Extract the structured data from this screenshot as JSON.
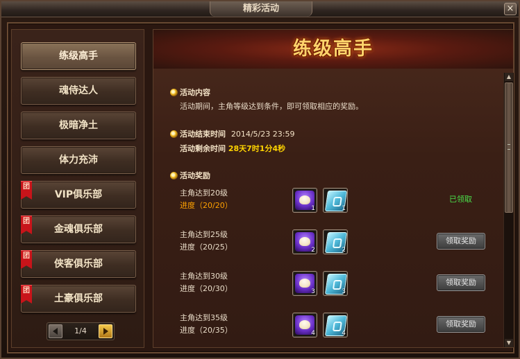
{
  "window": {
    "title": "精彩活动",
    "close_label": "×"
  },
  "sidebar": {
    "items": [
      {
        "label": "练级高手",
        "active": true,
        "badge": ""
      },
      {
        "label": "魂侍达人",
        "active": false,
        "badge": ""
      },
      {
        "label": "极暗净土",
        "active": false,
        "badge": ""
      },
      {
        "label": "体力充沛",
        "active": false,
        "badge": ""
      },
      {
        "label": "VIP俱乐部",
        "active": false,
        "badge": "团"
      },
      {
        "label": "金魂俱乐部",
        "active": false,
        "badge": "团"
      },
      {
        "label": "侠客俱乐部",
        "active": false,
        "badge": "团"
      },
      {
        "label": "土豪俱乐部",
        "active": false,
        "badge": "团"
      }
    ],
    "pager": {
      "text": "1/4"
    }
  },
  "main": {
    "title": "练级高手",
    "content_heading": "活动内容",
    "content_text": "活动期间，主角等级达到条件，即可领取相应的奖励。",
    "end_time_label": "活动结束时间",
    "end_time_value": "2014/5/23 23:59",
    "remaining_label": "活动剩余时间",
    "remaining_value": "28天7时1分4秒",
    "rewards_heading": "活动奖励",
    "rewards": [
      {
        "requirement": "主角达到20级",
        "progress": "进度（20/20）",
        "progress_done": true,
        "item1_count": "1",
        "item2_count": "1",
        "status": "已领取",
        "button": ""
      },
      {
        "requirement": "主角达到25级",
        "progress": "进度（20/25）",
        "progress_done": false,
        "item1_count": "2",
        "item2_count": "2",
        "status": "",
        "button": "领取奖励"
      },
      {
        "requirement": "主角达到30级",
        "progress": "进度（20/30）",
        "progress_done": false,
        "item1_count": "3",
        "item2_count": "3",
        "status": "",
        "button": "领取奖励"
      },
      {
        "requirement": "主角达到35级",
        "progress": "进度（20/35）",
        "progress_done": false,
        "item1_count": "4",
        "item2_count": "4",
        "status": "",
        "button": "领取奖励"
      }
    ]
  },
  "colors": {
    "accent_gold": "#ffd36b",
    "claimed_green": "#4ae04a",
    "progress_orange": "#ffa200",
    "badge_red": "#c8141a"
  },
  "icons": {
    "item1": "steamed-bun-icon",
    "item2": "skill-book-icon",
    "bullet": "gold-ring-bullet-icon"
  }
}
